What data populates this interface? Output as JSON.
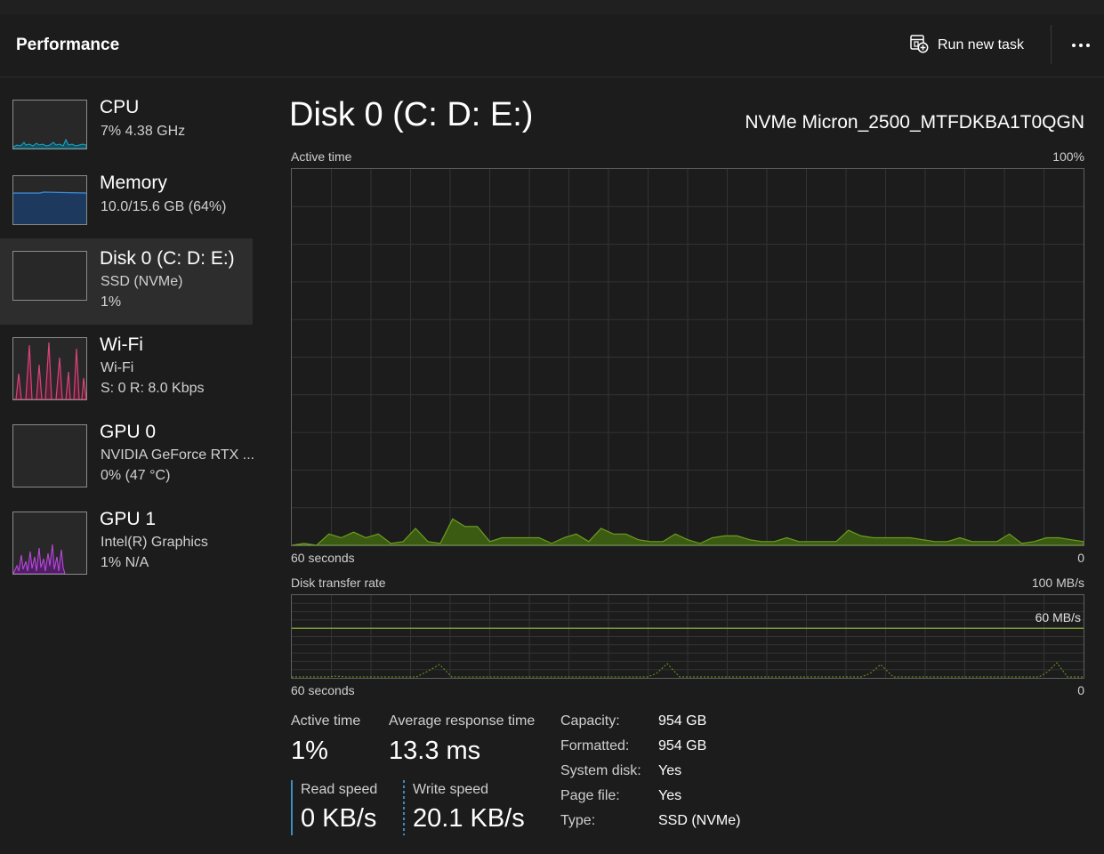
{
  "header": {
    "title": "Performance",
    "run_new_task": "Run new task",
    "more_icon": "more-horizontal-icon",
    "run_task_icon": "run-task-icon"
  },
  "sidebar": {
    "items": [
      {
        "title": "CPU",
        "line1": "7%  4.38 GHz",
        "line2": "",
        "graph_color": "#1aa6c7",
        "selected": false
      },
      {
        "title": "Memory",
        "line1": "10.0/15.6 GB (64%)",
        "line2": "",
        "graph_color": "#3c8fe0",
        "selected": false
      },
      {
        "title": "Disk 0 (C: D: E:)",
        "line1": "SSD (NVMe)",
        "line2": "1%",
        "graph_color": "#6a9a1f",
        "selected": true
      },
      {
        "title": "Wi-Fi",
        "line1": "Wi-Fi",
        "line2": "S: 0  R: 8.0 Kbps",
        "graph_color": "#d6457a",
        "selected": false
      },
      {
        "title": "GPU 0",
        "line1": "NVIDIA GeForce RTX ...",
        "line2": "0%  (47 °C)",
        "graph_color": "#9b4dca",
        "selected": false
      },
      {
        "title": "GPU 1",
        "line1": "Intel(R) Graphics",
        "line2": "1%  N/A",
        "graph_color": "#b548d6",
        "selected": false
      }
    ]
  },
  "main": {
    "title": "Disk 0 (C: D: E:)",
    "device": "NVMe Micron_2500_MTFDKBA1T0QGN",
    "active_time_graph": {
      "label": "Active time",
      "max_label": "100%",
      "left_label": "60 seconds",
      "right_label": "0",
      "values_percent": [
        0,
        0.5,
        0,
        3,
        2,
        3.5,
        2,
        3,
        0.5,
        1,
        4.5,
        1,
        0.5,
        7,
        5,
        5,
        1,
        2,
        2,
        2,
        2,
        0.5,
        2,
        3,
        1,
        4.5,
        3,
        3,
        1.5,
        1,
        1,
        3,
        1.5,
        0.5,
        2,
        2.5,
        2.5,
        1.5,
        1,
        1,
        2,
        1,
        1,
        1,
        1,
        4,
        2.5,
        2,
        2,
        2,
        2,
        1.5,
        1,
        1,
        2,
        1,
        1,
        1,
        3,
        0.5,
        1,
        2,
        2,
        1.5,
        1
      ]
    },
    "transfer_graph": {
      "label": "Disk transfer rate",
      "max_label": "100 MB/s",
      "line_label": "60 MB/s",
      "line_value": 60,
      "left_label": "60 seconds",
      "right_label": "0"
    },
    "stats": {
      "active_time_label": "Active time",
      "active_time_value": "1%",
      "avg_response_label": "Average response time",
      "avg_response_value": "13.3 ms",
      "read_speed_label": "Read speed",
      "read_speed_value": "0 KB/s",
      "write_speed_label": "Write speed",
      "write_speed_value": "20.1 KB/s",
      "read_color": "#3a8fbf",
      "write_color": "#3a8fbf"
    },
    "properties": [
      {
        "key": "Capacity:",
        "value": "954 GB"
      },
      {
        "key": "Formatted:",
        "value": "954 GB"
      },
      {
        "key": "System disk:",
        "value": "Yes"
      },
      {
        "key": "Page file:",
        "value": "Yes"
      },
      {
        "key": "Type:",
        "value": "SSD (NVMe)"
      }
    ]
  },
  "colors": {
    "disk_accent": "#6b9e1f",
    "disk_fill": "#3b5a12",
    "background": "#1c1c1c",
    "selected": "#2d2d2d"
  }
}
